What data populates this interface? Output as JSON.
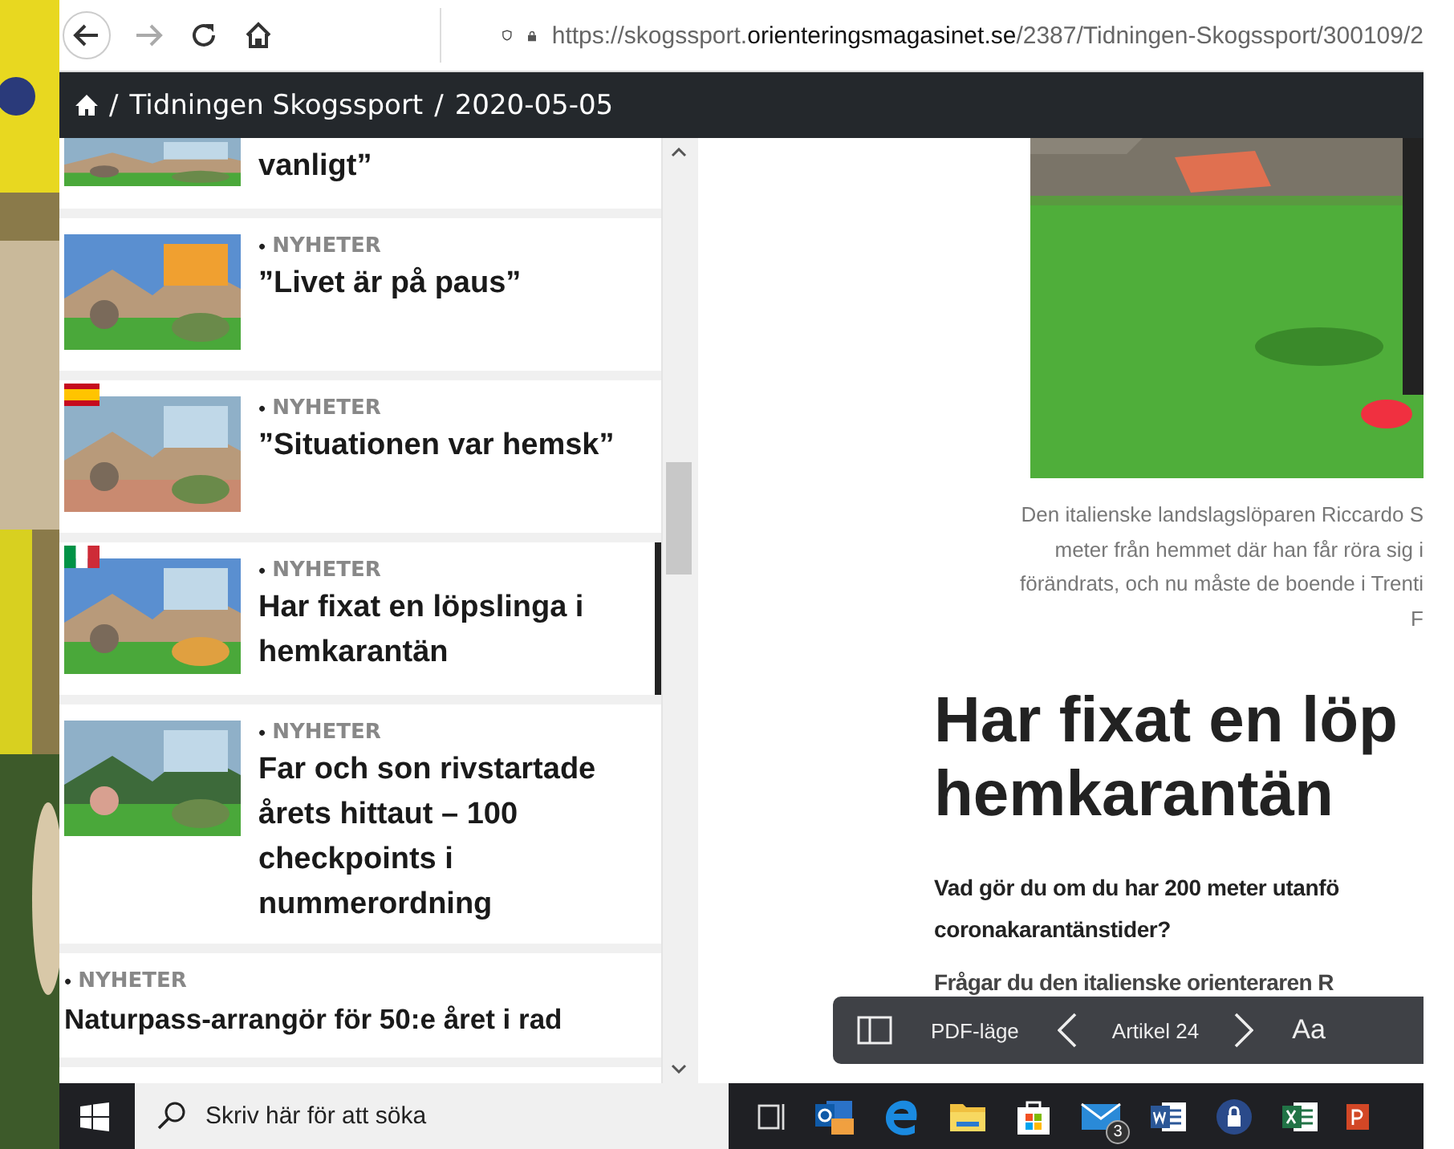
{
  "browser": {
    "url_prefix": "https://skogssport.",
    "url_domain": "orienteringsmagasinet.se",
    "url_path": "/2387/Tidningen-Skogssport/300109/2"
  },
  "breadcrumb": {
    "items": [
      "Tidningen Skogssport",
      "2020-05-05"
    ],
    "separator": "/"
  },
  "sidebar": {
    "bullet": "•",
    "items": [
      {
        "kind": "partial",
        "title": "vanligt”",
        "selected": false
      },
      {
        "kind": "thumb",
        "category": "NYHETER",
        "title": "”Livet är på paus”",
        "selected": false
      },
      {
        "kind": "thumb",
        "flag": {
          "kind": "spain"
        },
        "category": "NYHETER",
        "title": "”Situationen var hemsk”",
        "selected": false
      },
      {
        "kind": "thumb",
        "flag": {
          "kind": "italy"
        },
        "category": "NYHETER",
        "title": "Har fixat en löpslinga i hemkarantän",
        "selected": true
      },
      {
        "kind": "thumb",
        "category": "NYHETER",
        "title": "Far och son rivstartade årets hittaut – 100 checkpoints i nummerordning",
        "selected": false
      },
      {
        "kind": "text",
        "category": "NYHETER",
        "title": "Naturpass-arrangör för 50:e året i rad",
        "selected": false
      }
    ]
  },
  "article": {
    "caption_lines": [
      "Den italienske landslagslöparen Riccardo S",
      "meter från hemmet där han får röra sig i",
      "förändrats, och nu måste de boende i Trenti",
      "F"
    ],
    "heading_lines": [
      "Har fixat en löp",
      "hemkarantän"
    ],
    "lead_lines": [
      "Vad gör du om du har 200 meter utanfö",
      "coronakarantänstider?"
    ],
    "body_lines": [
      "Frågar du den italienske orienteraren R"
    ]
  },
  "reader_toolbar": {
    "pdf_label": "PDF-läge",
    "article_label": "Artikel 24",
    "font_label": "Aa"
  },
  "taskbar": {
    "search_placeholder": "Skriv här för att söka",
    "mail_badge": "3"
  }
}
